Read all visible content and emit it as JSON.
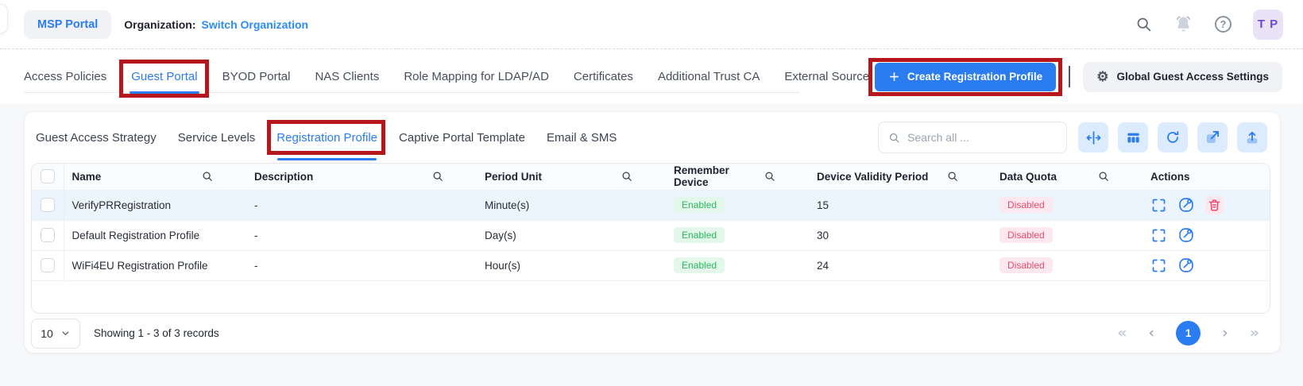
{
  "header": {
    "portal_label": "MSP Portal",
    "organization_label": "Organization:",
    "organization_name": "Switch Organization",
    "avatar_initials": "T P"
  },
  "nav_tabs": {
    "access_policies": "Access Policies",
    "guest_portal": "Guest Portal",
    "byod_portal": "BYOD Portal",
    "nas_clients": "NAS Clients",
    "role_mapping": "Role Mapping for LDAP/AD",
    "certificates": "Certificates",
    "additional_trust_ca": "Additional Trust CA",
    "external_source": "External Source"
  },
  "page_actions": {
    "create_label": "Create Registration Profile",
    "settings_label": "Global Guest Access Settings"
  },
  "subtabs": {
    "guest_access_strategy": "Guest Access Strategy",
    "service_levels": "Service Levels",
    "registration_profile": "Registration Profile",
    "captive_portal_template": "Captive Portal Template",
    "email_sms": "Email & SMS"
  },
  "toolbar": {
    "search_placeholder": "Search all ..."
  },
  "table": {
    "headers": {
      "name": "Name",
      "description": "Description",
      "period_unit": "Period Unit",
      "remember_device": "Remember Device",
      "device_validity_period": "Device Validity Period",
      "data_quota": "Data Quota",
      "actions": "Actions"
    },
    "rows": [
      {
        "name": "VerifyPRRegistration",
        "description": "-",
        "period_unit": "Minute(s)",
        "remember_device": "Enabled",
        "device_validity_period": "15",
        "data_quota": "Disabled"
      },
      {
        "name": "Default Registration Profile",
        "description": "-",
        "period_unit": "Day(s)",
        "remember_device": "Enabled",
        "device_validity_period": "30",
        "data_quota": "Disabled"
      },
      {
        "name": "WiFi4EU Registration Profile",
        "description": "-",
        "period_unit": "Hour(s)",
        "remember_device": "Enabled",
        "device_validity_period": "24",
        "data_quota": "Disabled"
      }
    ]
  },
  "pagination": {
    "page_size": "10",
    "summary": "Showing 1 - 3 of 3 records",
    "current_page": "1"
  },
  "icons": {
    "gear": "⚙",
    "first": "«",
    "prev": "‹",
    "next": "›",
    "last": "»"
  },
  "colors": {
    "accent_blue": "#2a7cf0",
    "annotation_red": "#b5171c",
    "enabled_green": "#28b95c",
    "disabled_red": "#e94c6f"
  }
}
